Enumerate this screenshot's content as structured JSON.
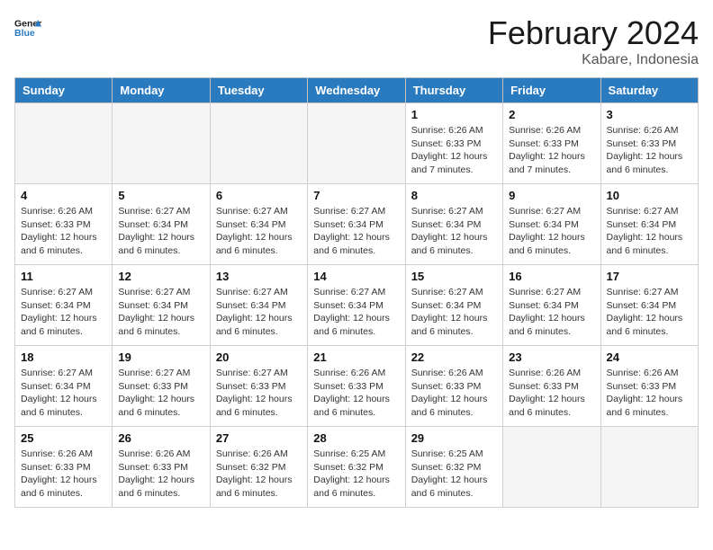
{
  "header": {
    "logo_line1": "General",
    "logo_line2": "Blue",
    "title": "February 2024",
    "subtitle": "Kabare, Indonesia"
  },
  "days_of_week": [
    "Sunday",
    "Monday",
    "Tuesday",
    "Wednesday",
    "Thursday",
    "Friday",
    "Saturday"
  ],
  "weeks": [
    [
      {
        "day": "",
        "detail": ""
      },
      {
        "day": "",
        "detail": ""
      },
      {
        "day": "",
        "detail": ""
      },
      {
        "day": "",
        "detail": ""
      },
      {
        "day": "1",
        "detail": "Sunrise: 6:26 AM\nSunset: 6:33 PM\nDaylight: 12 hours\nand 7 minutes."
      },
      {
        "day": "2",
        "detail": "Sunrise: 6:26 AM\nSunset: 6:33 PM\nDaylight: 12 hours\nand 7 minutes."
      },
      {
        "day": "3",
        "detail": "Sunrise: 6:26 AM\nSunset: 6:33 PM\nDaylight: 12 hours\nand 6 minutes."
      }
    ],
    [
      {
        "day": "4",
        "detail": "Sunrise: 6:26 AM\nSunset: 6:33 PM\nDaylight: 12 hours\nand 6 minutes."
      },
      {
        "day": "5",
        "detail": "Sunrise: 6:27 AM\nSunset: 6:34 PM\nDaylight: 12 hours\nand 6 minutes."
      },
      {
        "day": "6",
        "detail": "Sunrise: 6:27 AM\nSunset: 6:34 PM\nDaylight: 12 hours\nand 6 minutes."
      },
      {
        "day": "7",
        "detail": "Sunrise: 6:27 AM\nSunset: 6:34 PM\nDaylight: 12 hours\nand 6 minutes."
      },
      {
        "day": "8",
        "detail": "Sunrise: 6:27 AM\nSunset: 6:34 PM\nDaylight: 12 hours\nand 6 minutes."
      },
      {
        "day": "9",
        "detail": "Sunrise: 6:27 AM\nSunset: 6:34 PM\nDaylight: 12 hours\nand 6 minutes."
      },
      {
        "day": "10",
        "detail": "Sunrise: 6:27 AM\nSunset: 6:34 PM\nDaylight: 12 hours\nand 6 minutes."
      }
    ],
    [
      {
        "day": "11",
        "detail": "Sunrise: 6:27 AM\nSunset: 6:34 PM\nDaylight: 12 hours\nand 6 minutes."
      },
      {
        "day": "12",
        "detail": "Sunrise: 6:27 AM\nSunset: 6:34 PM\nDaylight: 12 hours\nand 6 minutes."
      },
      {
        "day": "13",
        "detail": "Sunrise: 6:27 AM\nSunset: 6:34 PM\nDaylight: 12 hours\nand 6 minutes."
      },
      {
        "day": "14",
        "detail": "Sunrise: 6:27 AM\nSunset: 6:34 PM\nDaylight: 12 hours\nand 6 minutes."
      },
      {
        "day": "15",
        "detail": "Sunrise: 6:27 AM\nSunset: 6:34 PM\nDaylight: 12 hours\nand 6 minutes."
      },
      {
        "day": "16",
        "detail": "Sunrise: 6:27 AM\nSunset: 6:34 PM\nDaylight: 12 hours\nand 6 minutes."
      },
      {
        "day": "17",
        "detail": "Sunrise: 6:27 AM\nSunset: 6:34 PM\nDaylight: 12 hours\nand 6 minutes."
      }
    ],
    [
      {
        "day": "18",
        "detail": "Sunrise: 6:27 AM\nSunset: 6:34 PM\nDaylight: 12 hours\nand 6 minutes."
      },
      {
        "day": "19",
        "detail": "Sunrise: 6:27 AM\nSunset: 6:33 PM\nDaylight: 12 hours\nand 6 minutes."
      },
      {
        "day": "20",
        "detail": "Sunrise: 6:27 AM\nSunset: 6:33 PM\nDaylight: 12 hours\nand 6 minutes."
      },
      {
        "day": "21",
        "detail": "Sunrise: 6:26 AM\nSunset: 6:33 PM\nDaylight: 12 hours\nand 6 minutes."
      },
      {
        "day": "22",
        "detail": "Sunrise: 6:26 AM\nSunset: 6:33 PM\nDaylight: 12 hours\nand 6 minutes."
      },
      {
        "day": "23",
        "detail": "Sunrise: 6:26 AM\nSunset: 6:33 PM\nDaylight: 12 hours\nand 6 minutes."
      },
      {
        "day": "24",
        "detail": "Sunrise: 6:26 AM\nSunset: 6:33 PM\nDaylight: 12 hours\nand 6 minutes."
      }
    ],
    [
      {
        "day": "25",
        "detail": "Sunrise: 6:26 AM\nSunset: 6:33 PM\nDaylight: 12 hours\nand 6 minutes."
      },
      {
        "day": "26",
        "detail": "Sunrise: 6:26 AM\nSunset: 6:33 PM\nDaylight: 12 hours\nand 6 minutes."
      },
      {
        "day": "27",
        "detail": "Sunrise: 6:26 AM\nSunset: 6:32 PM\nDaylight: 12 hours\nand 6 minutes."
      },
      {
        "day": "28",
        "detail": "Sunrise: 6:25 AM\nSunset: 6:32 PM\nDaylight: 12 hours\nand 6 minutes."
      },
      {
        "day": "29",
        "detail": "Sunrise: 6:25 AM\nSunset: 6:32 PM\nDaylight: 12 hours\nand 6 minutes."
      },
      {
        "day": "",
        "detail": ""
      },
      {
        "day": "",
        "detail": ""
      }
    ]
  ]
}
